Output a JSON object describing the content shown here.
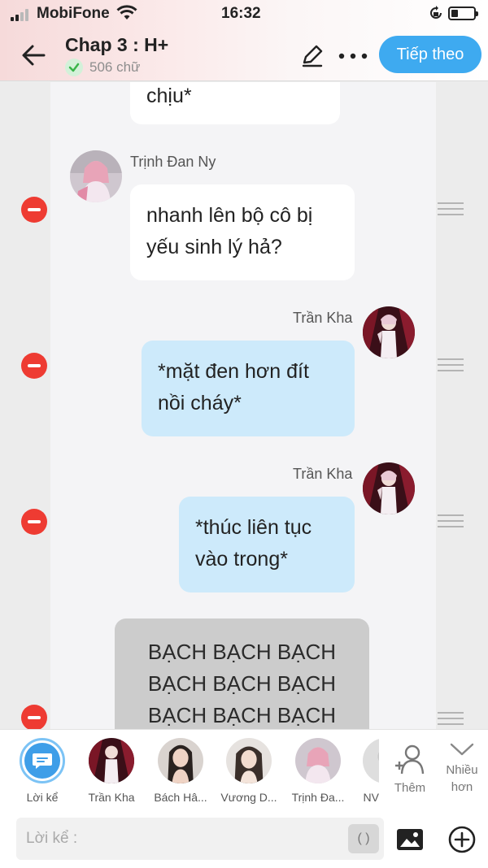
{
  "status_bar": {
    "carrier": "MobiFone",
    "time": "16:32"
  },
  "header": {
    "title": "Chap 3 : H+",
    "word_count": "506 chữ",
    "next_label": "Tiếp theo"
  },
  "messages": [
    {
      "side": "left",
      "text": "chịu*"
    },
    {
      "side": "left",
      "speaker": "Trịnh Đan Ny",
      "text": "nhanh lên bộ cô bị yếu sinh lý hả?"
    },
    {
      "side": "right",
      "speaker": "Trần Kha",
      "text": "*mặt đen hơn đít nồi cháy*"
    },
    {
      "side": "right",
      "speaker": "Trần Kha",
      "text": "*thúc liên tục vào trong*"
    },
    {
      "side": "narration",
      "text": "BẠCH BẠCH BẠCH BẠCH BẠCH BẠCH BẠCH BẠCH BẠCH"
    }
  ],
  "characters": [
    {
      "label": "Lời kể",
      "icon": "chat-bubble-icon"
    },
    {
      "label": "Trần Kha"
    },
    {
      "label": "Bách Hâ..."
    },
    {
      "label": "Vương D..."
    },
    {
      "label": "Trịnh Đa..."
    },
    {
      "label": "NV"
    }
  ],
  "controls": {
    "add_character_label": "Thêm",
    "collapse_label": "Nhiều hơn",
    "input_placeholder": "Lời kể :",
    "paren_button": "( )",
    "image_icon": "image-icon",
    "add_icon": "plus-circle-icon"
  },
  "colors": {
    "accent": "#3eaaf0",
    "delete": "#ee3b32",
    "right_bubble": "#cdeafb",
    "narration_bubble": "#cccccc"
  }
}
